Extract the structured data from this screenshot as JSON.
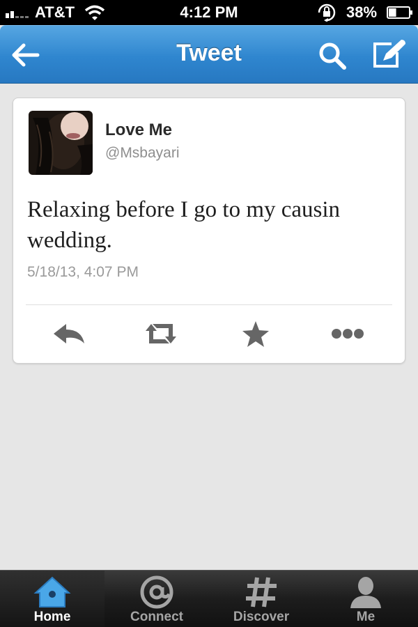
{
  "status_bar": {
    "carrier": "AT&T",
    "time": "4:12 PM",
    "battery": "38%",
    "battery_level": 0.38,
    "icons": [
      "signal-bars-icon",
      "wifi-icon",
      "rotation-lock-icon",
      "battery-icon"
    ]
  },
  "nav": {
    "title": "Tweet",
    "icons": [
      "back-arrow-icon",
      "search-icon",
      "compose-icon"
    ]
  },
  "tweet": {
    "display_name": "Love Me",
    "handle": "@Msbayari",
    "text": "Relaxing before I go to my causin wedding.",
    "timestamp": "5/18/13, 4:07 PM",
    "actions": [
      "reply-icon",
      "retweet-icon",
      "favorite-star-icon",
      "more-dots-icon"
    ]
  },
  "tabs": [
    {
      "label": "Home",
      "icon": "home-icon",
      "active": true
    },
    {
      "label": "Connect",
      "icon": "at-sign-icon",
      "active": false
    },
    {
      "label": "Discover",
      "icon": "hashtag-icon",
      "active": false
    },
    {
      "label": "Me",
      "icon": "person-icon",
      "active": false
    }
  ],
  "colors": {
    "nav_blue": "#2f86cf",
    "tab_bar": "#1d1d1d",
    "home_icon_blue": "#4aa7e8",
    "background": "#e6e6e6"
  }
}
